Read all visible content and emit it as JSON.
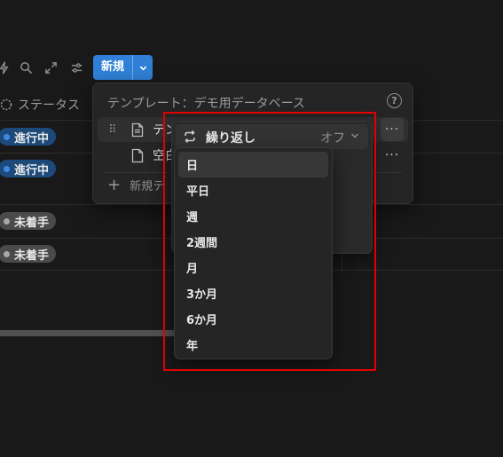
{
  "toolbar": {
    "icons": [
      "lightning-icon",
      "search-icon",
      "expand-icon",
      "settings-sliders-icon"
    ],
    "new_button_label": "新規"
  },
  "table": {
    "status_header": "ステータス",
    "rows": [
      {
        "status": "進行中",
        "color": "#1e4a7a"
      },
      {
        "status": "進行中",
        "color": "#1e4a7a"
      },
      {
        "status": "未着手",
        "color": "#4a4a48"
      },
      {
        "status": "未着手",
        "color": "#4a4a48"
      }
    ]
  },
  "template_popover": {
    "title": "テンプレート：デモ用データベース",
    "rows": [
      {
        "label": "テン"
      },
      {
        "label": "空白"
      }
    ],
    "add_label": "新規テ"
  },
  "repeat": {
    "label": "繰り返し",
    "value": "オフ"
  },
  "frequency_menu": {
    "items": [
      "日",
      "平日",
      "週",
      "2週間",
      "月",
      "3か月",
      "6か月",
      "年"
    ],
    "selected_index": 0
  },
  "colors": {
    "accent": "#2f80d6",
    "highlight_border": "#e00000"
  }
}
